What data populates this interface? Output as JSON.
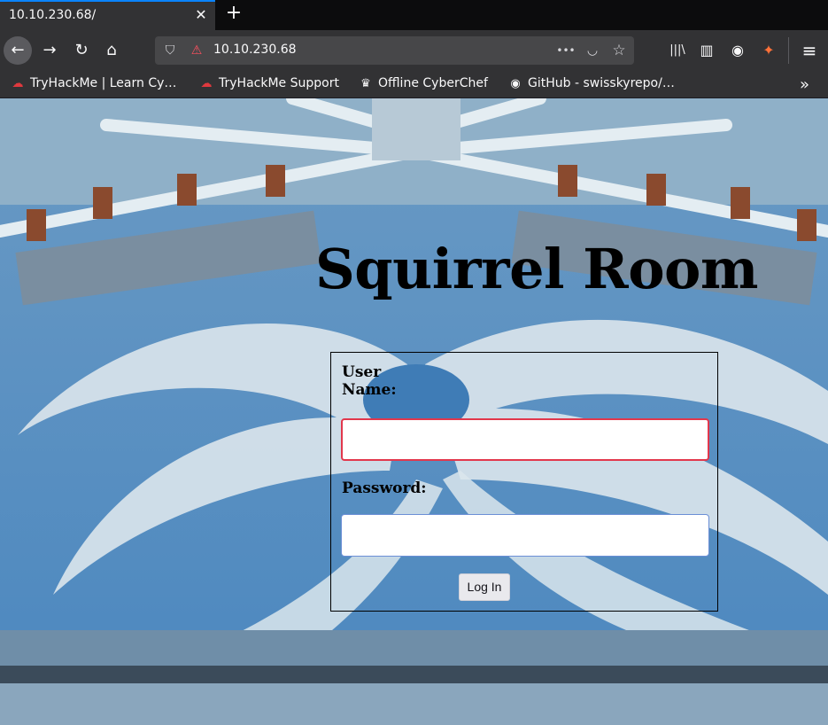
{
  "browser": {
    "tab_title": "10.10.230.68/",
    "tab_close_glyph": "✕",
    "new_tab_glyph": "+",
    "url": "10.10.230.68",
    "page_actions_glyph": "•••",
    "icons": {
      "back": "←",
      "forward": "→",
      "reload": "↻",
      "home": "⌂",
      "shield": "⛉",
      "insecure": "⚠",
      "pocket": "◡",
      "star": "☆",
      "library": "|||\\",
      "sidebar": "▥",
      "account": "◉",
      "extension": "✦",
      "menu": "≡"
    },
    "bookmarks": [
      {
        "label": "TryHackMe | Learn Cy…",
        "icon": "☁"
      },
      {
        "label": "TryHackMe Support",
        "icon": "☁"
      },
      {
        "label": "Offline CyberChef",
        "icon": "♛"
      },
      {
        "label": "GitHub - swisskyrepo/…",
        "icon": "◉"
      }
    ],
    "bookmarks_overflow": "»"
  },
  "page": {
    "title": "Squirrel Room",
    "login": {
      "username_label": "User Name:",
      "username_value": "",
      "password_label": "Password:",
      "password_value": "",
      "submit_label": "Log In"
    }
  },
  "colors": {
    "accent_tab": "#0a84ff",
    "focus_ring": "#e2374c",
    "browser_chrome": "#323234"
  }
}
